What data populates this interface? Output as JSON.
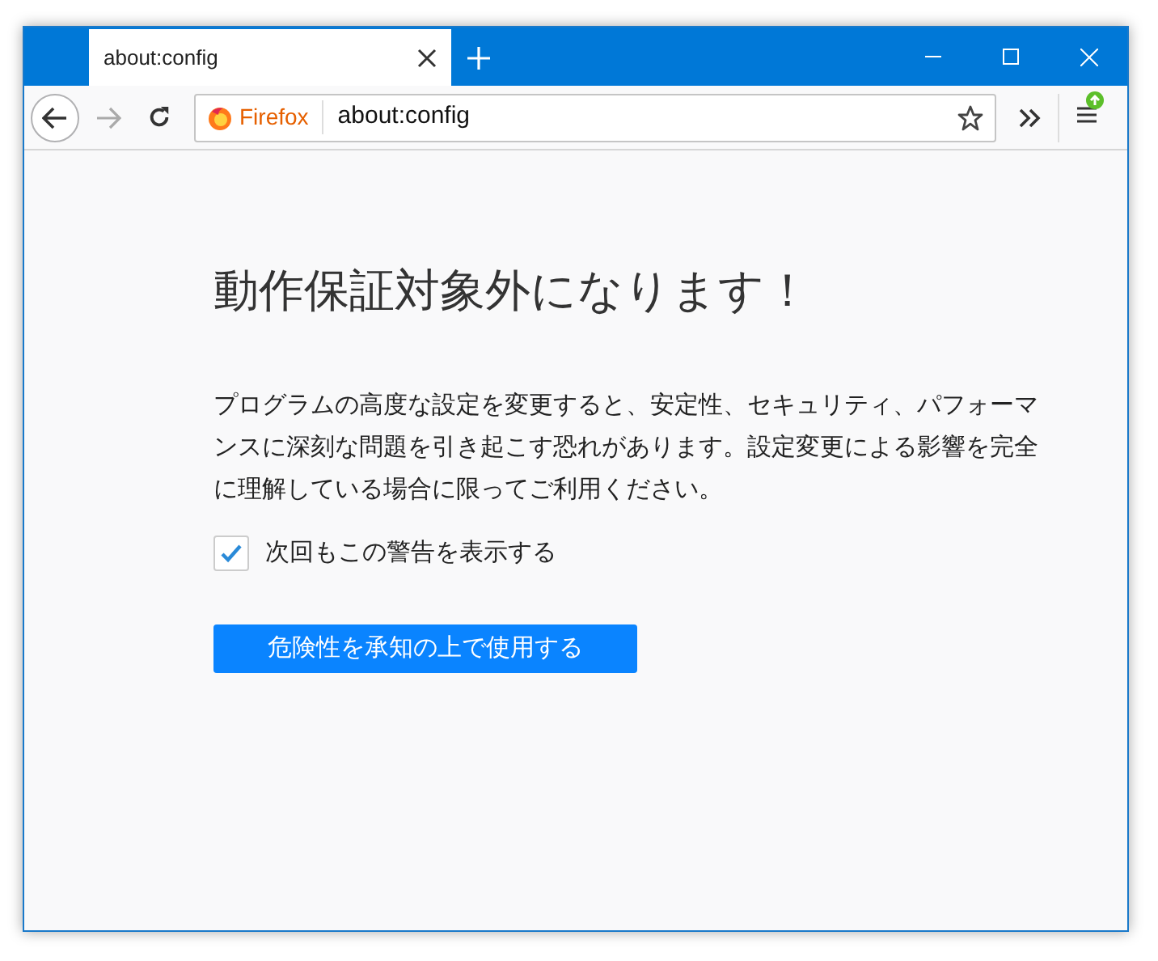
{
  "tab": {
    "title": "about:config",
    "selected": true
  },
  "address_bar": {
    "identity": "Firefox",
    "url": "about:config"
  },
  "page": {
    "title": "動作保証対象外になります！",
    "warning": "プログラムの高度な設定を変更すると、安定性、セキュリティ、パフォーマンスに深刻な問題を引き起こす恐れがあります。設定変更による影響を完全に理解している場合に限ってご利用ください。",
    "checkbox": {
      "label": "次回もこの警告を表示する",
      "checked": true
    },
    "button": "危険性を承知の上で使用する"
  }
}
